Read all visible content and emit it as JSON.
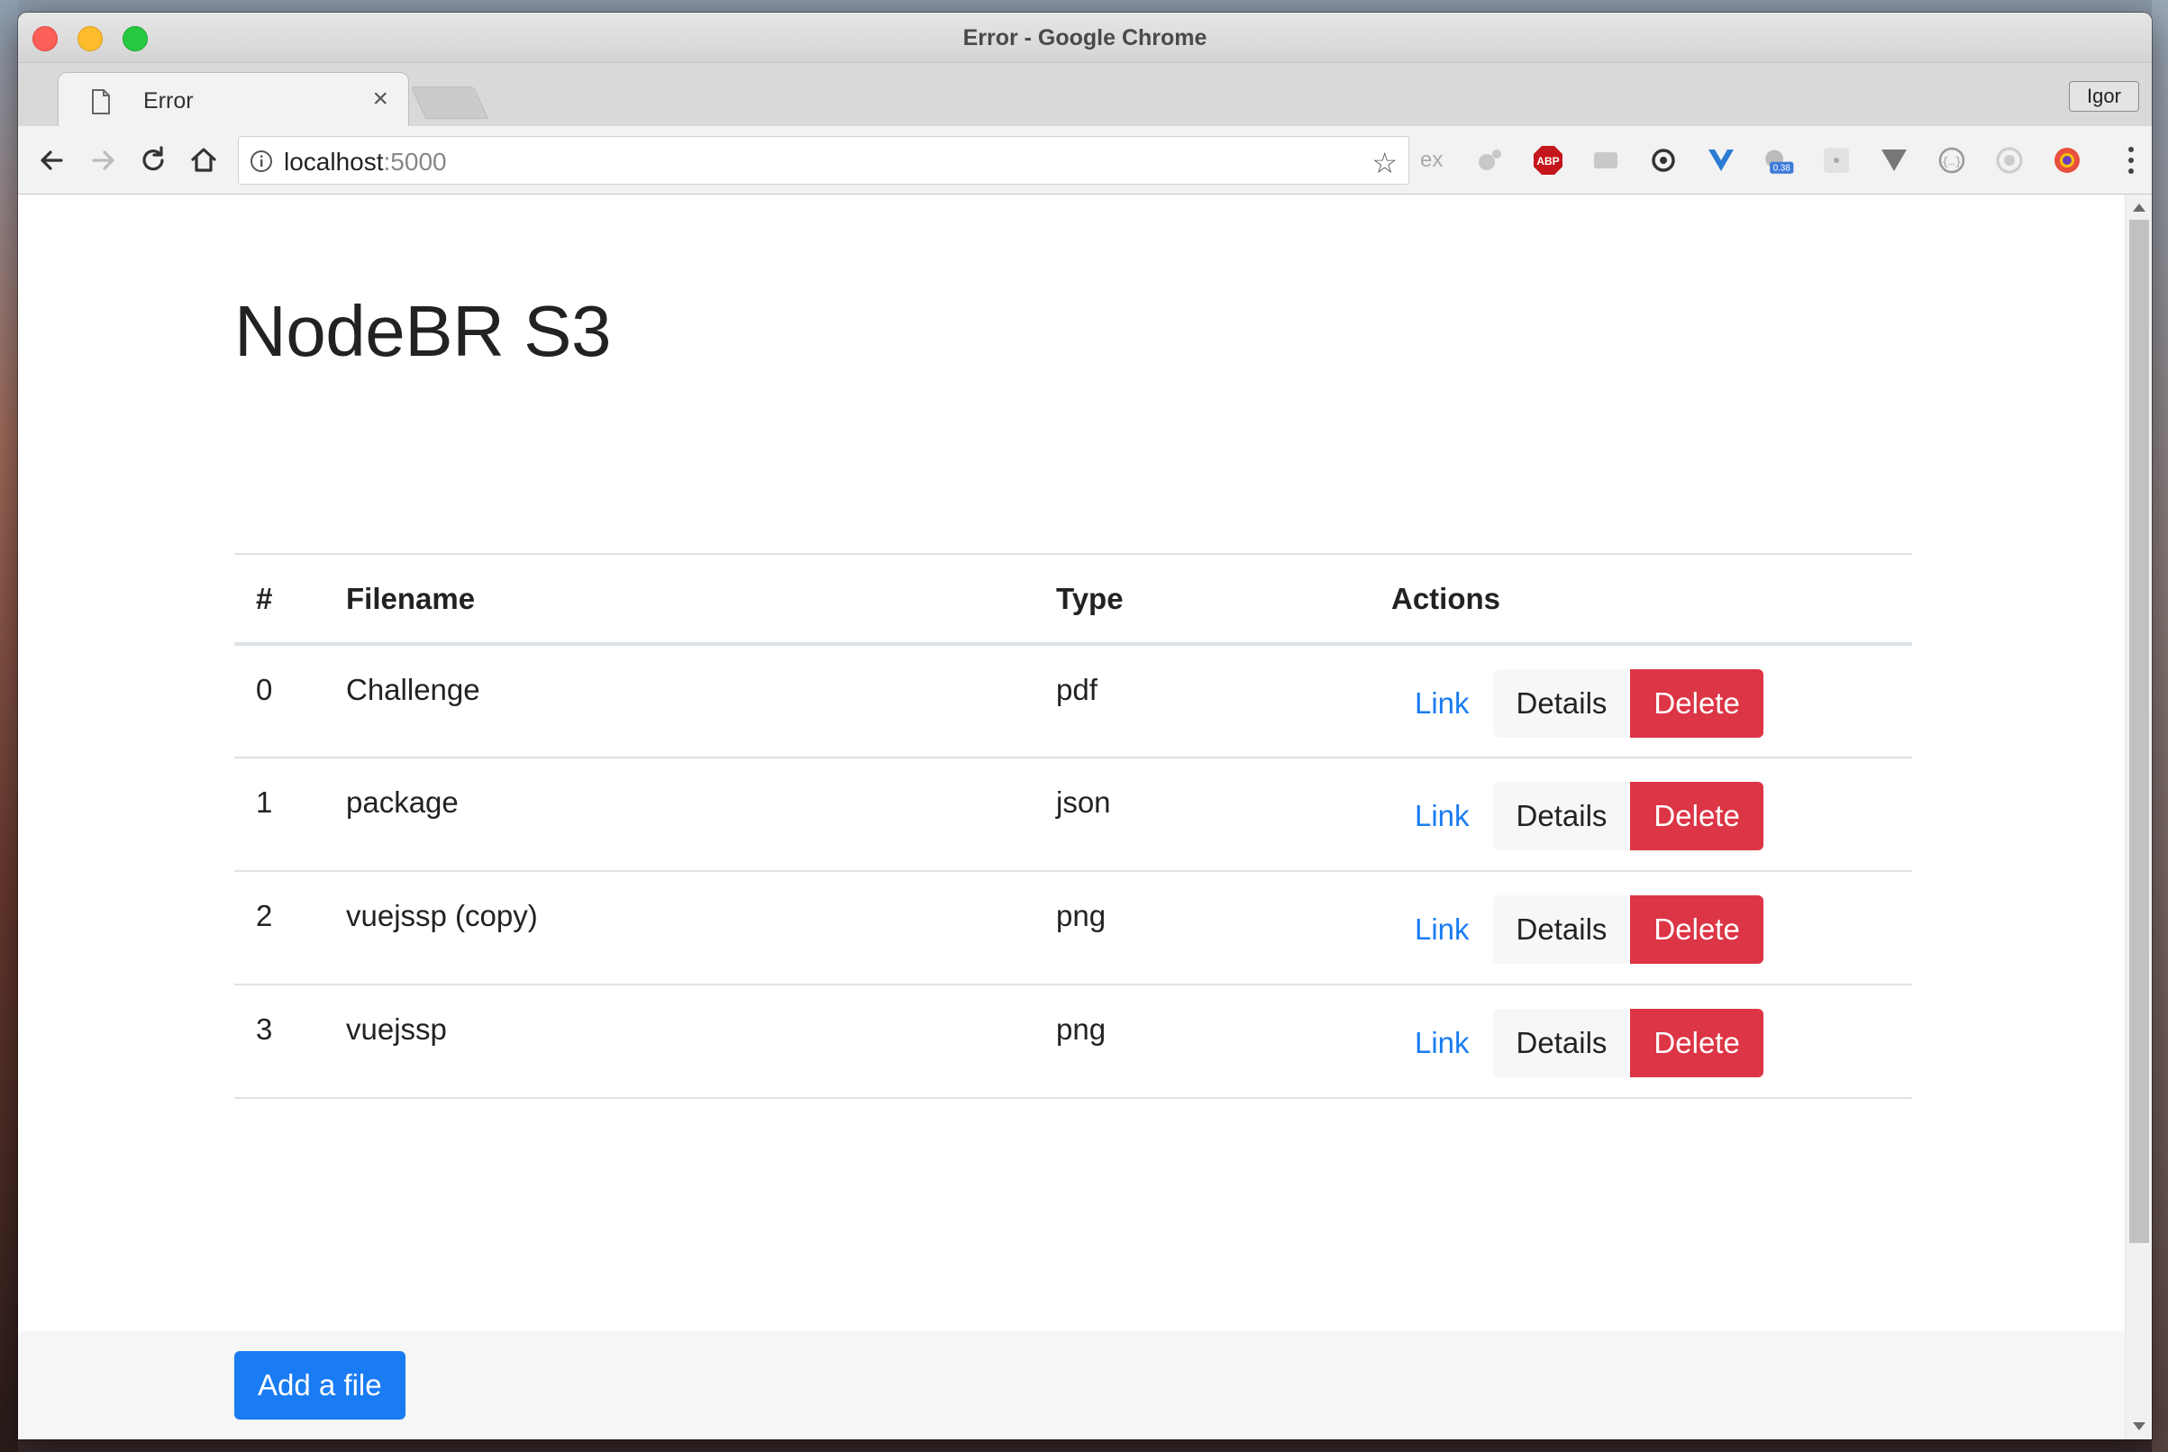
{
  "window": {
    "title": "Error - Google Chrome"
  },
  "tab": {
    "title": "Error"
  },
  "profile": {
    "name": "Igor"
  },
  "omnibox": {
    "host": "localhost",
    "port": ":5000"
  },
  "extensions": [
    {
      "name": "ex-extension-icon",
      "label": "ex"
    },
    {
      "name": "abp-extension-icon",
      "label": "ABP"
    },
    {
      "name": "speed-extension-badge",
      "label": "0.38"
    }
  ],
  "page": {
    "title": "NodeBR S3"
  },
  "table": {
    "headers": [
      "#",
      "Filename",
      "Type",
      "Actions"
    ],
    "rows": [
      {
        "index": "0",
        "filename": "Challenge",
        "type": "pdf"
      },
      {
        "index": "1",
        "filename": "package",
        "type": "json"
      },
      {
        "index": "2",
        "filename": "vuejssp (copy)",
        "type": "png"
      },
      {
        "index": "3",
        "filename": "vuejssp",
        "type": "png"
      }
    ],
    "action_labels": {
      "link": "Link",
      "details": "Details",
      "delete": "Delete"
    }
  },
  "footer": {
    "add_button": "Add a file"
  },
  "colors": {
    "primary": "#1a7cf2",
    "danger": "#dc3545",
    "link": "#1a7cf2"
  }
}
